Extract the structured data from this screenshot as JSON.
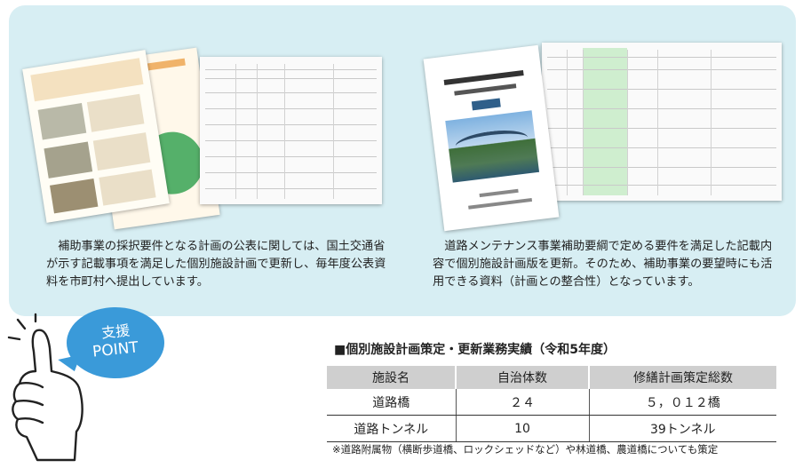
{
  "left_caption": "補助事業の採択要件となる計画の公表に関しては、国土交通省が示す記載事項を満足した個別施設計画で更新し、毎年度公表資料を市町村へ提出しています。",
  "right_caption": "道路メンテナンス事業補助要綱で定める要件を満足した記載内容で個別施設計画版を更新。そのため、補助事業の要望時にも活用できる資料（計画との整合性）となっています。",
  "badge": {
    "line1": "支援",
    "line2": "POINT"
  },
  "table": {
    "title": "■個別施設計画策定・更新業務実績（令和5年度）",
    "headers": [
      "施設名",
      "自治体数",
      "修繕計画策定総数"
    ],
    "rows": [
      [
        "道路橋",
        "２４",
        "５，０１２橋"
      ],
      [
        "道路トンネル",
        "10",
        "39トンネル"
      ]
    ]
  },
  "note": "※道路附属物（横断歩道橋、ロックシェッドなど）や林道橋、農道橋についても策定",
  "colors": {
    "panel": "#d7eef3",
    "badge": "#3a9ad9",
    "table_header": "#cfcfcf"
  },
  "icons": [
    "thumbs-up-hand-icon"
  ]
}
